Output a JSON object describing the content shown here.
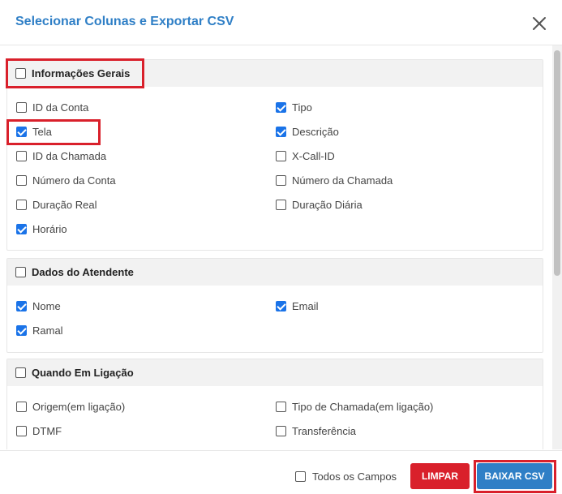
{
  "dialog": {
    "title": "Selecionar Colunas e Exportar CSV"
  },
  "sections": [
    {
      "title": "Informações Gerais",
      "checked": false,
      "items": [
        {
          "label": "ID da Conta",
          "checked": false
        },
        {
          "label": "Tipo",
          "checked": true
        },
        {
          "label": "Tela",
          "checked": true
        },
        {
          "label": "Descrição",
          "checked": true
        },
        {
          "label": "ID da Chamada",
          "checked": false
        },
        {
          "label": "X-Call-ID",
          "checked": false
        },
        {
          "label": "Número da Conta",
          "checked": false
        },
        {
          "label": "Número da Chamada",
          "checked": false
        },
        {
          "label": "Duração Real",
          "checked": false
        },
        {
          "label": "Duração Diária",
          "checked": false
        },
        {
          "label": "Horário",
          "checked": true
        }
      ]
    },
    {
      "title": "Dados do Atendente",
      "checked": false,
      "items": [
        {
          "label": "Nome",
          "checked": true
        },
        {
          "label": "Email",
          "checked": true
        },
        {
          "label": "Ramal",
          "checked": true
        }
      ]
    },
    {
      "title": "Quando Em Ligação",
      "checked": false,
      "items": [
        {
          "label": "Origem(em ligação)",
          "checked": false
        },
        {
          "label": "Tipo de Chamada(em ligação)",
          "checked": false
        },
        {
          "label": "DTMF",
          "checked": false
        },
        {
          "label": "Transferência",
          "checked": false
        }
      ]
    }
  ],
  "footer": {
    "all_fields_label": "Todos os Campos",
    "all_fields_checked": false,
    "clear_label": "LIMPAR",
    "download_label": "BAIXAR CSV"
  },
  "colors": {
    "title": "#2f7fc6",
    "checkbox_checked": "#1a73e8",
    "clear_button": "#d9202b",
    "download_button": "#2f7fc6",
    "highlight": "#d9202b"
  },
  "icons": {
    "close": "close-icon"
  }
}
